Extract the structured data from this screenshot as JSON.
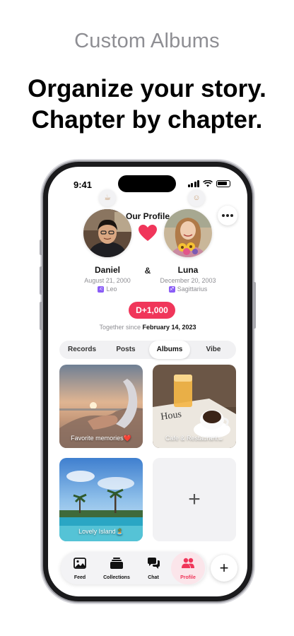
{
  "marketing": {
    "subtitle": "Custom Albums",
    "headline_line1": "Organize your story.",
    "headline_line2": "Chapter by chapter."
  },
  "status_bar": {
    "time": "9:41"
  },
  "profile": {
    "title": "Our Profile",
    "ampersand": "&",
    "person1": {
      "name": "Daniel",
      "birthday": "August 21, 2000",
      "zodiac": "Leo",
      "zodiac_icon": "leo-sign-icon"
    },
    "person2": {
      "name": "Luna",
      "birthday": "December 20, 2003",
      "zodiac": "Sagittarius",
      "zodiac_icon": "sagittarius-sign-icon"
    },
    "dday": "D+1,000",
    "together_prefix": "Together since",
    "together_date": "February 14, 2023"
  },
  "tabs": [
    {
      "label": "Records",
      "active": false
    },
    {
      "label": "Posts",
      "active": false
    },
    {
      "label": "Albums",
      "active": true
    },
    {
      "label": "Vibe",
      "active": false
    }
  ],
  "albums": [
    {
      "label": "Favorite memories❤️"
    },
    {
      "label": "Cafe & Restaurant☕"
    },
    {
      "label": "Lovely Island🏝️"
    }
  ],
  "add_album_symbol": "+",
  "bottom_nav": [
    {
      "label": "Feed",
      "icon": "photo-icon",
      "active": false
    },
    {
      "label": "Collections",
      "icon": "collections-icon",
      "active": false
    },
    {
      "label": "Chat",
      "icon": "chat-bubbles-icon",
      "active": false
    },
    {
      "label": "Profile",
      "icon": "people-icon",
      "active": true
    }
  ],
  "fab_symbol": "+",
  "colors": {
    "accent": "#f0365a",
    "heart": "#f0365a",
    "tab_active_bg": "#ffffff"
  }
}
